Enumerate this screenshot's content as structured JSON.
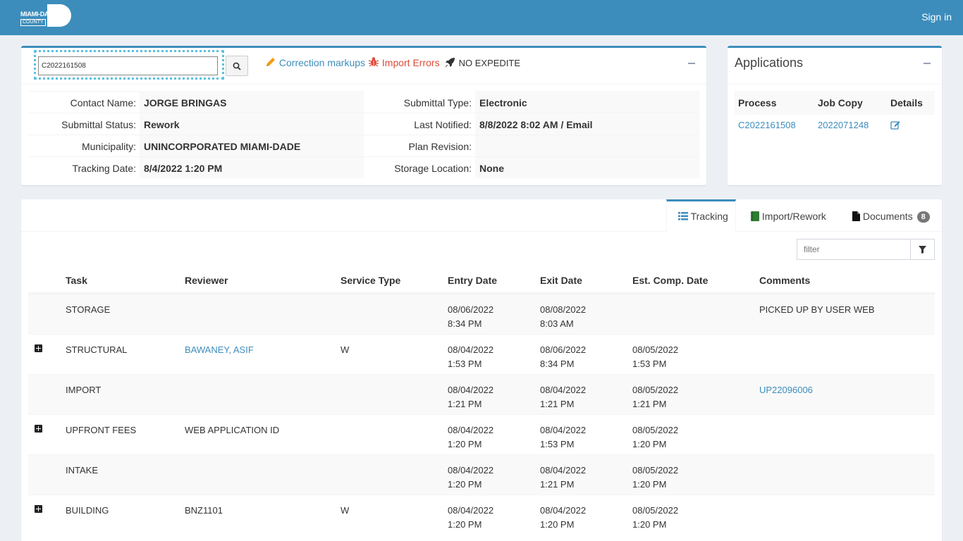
{
  "header": {
    "logo_text": "MIAMI-DADE",
    "logo_county": "COUNTY",
    "sign_in": "Sign in",
    "colors": {
      "bar": "#3c8dbc",
      "link": "#3c8dbc",
      "import_errors": "#dd4b39",
      "pencil": "#f39c12"
    }
  },
  "search": {
    "value": "C2022161508",
    "search_icon": "search-icon"
  },
  "toolbar": {
    "correction_markups": "Correction markups",
    "import_errors": "Import Errors",
    "no_expedite": "NO EXPEDITE"
  },
  "info": {
    "contact_name_label": "Contact Name:",
    "contact_name": "JORGE BRINGAS",
    "submittal_status_label": "Submittal Status:",
    "submittal_status": "Rework",
    "municipality_label": "Municipality:",
    "municipality": "UNINCORPORATED MIAMI-DADE",
    "tracking_date_label": "Tracking Date:",
    "tracking_date": "8/4/2022 1:20 PM",
    "submittal_type_label": "Submittal Type:",
    "submittal_type": "Electronic",
    "last_notified_label": "Last Notified:",
    "last_notified": "8/8/2022 8:02 AM / Email",
    "plan_revision_label": "Plan Revision:",
    "plan_revision": "",
    "storage_location_label": "Storage Location:",
    "storage_location": "None"
  },
  "applications": {
    "title": "Applications",
    "headers": [
      "Process",
      "Job Copy",
      "Details"
    ],
    "rows": [
      {
        "process": "C2022161508",
        "job_copy": "2022071248",
        "details_icon": "edit-icon"
      }
    ]
  },
  "tabs": [
    {
      "label": "Tracking",
      "icon": "list-icon",
      "active": true
    },
    {
      "label": "Import/Rework",
      "icon": "book-icon",
      "active": false
    },
    {
      "label": "Documents",
      "icon": "file-icon",
      "active": false,
      "badge": "8"
    }
  ],
  "filter": {
    "placeholder": "filter"
  },
  "table": {
    "headers": [
      "Task",
      "Reviewer",
      "Service Type",
      "Entry Date",
      "Exit Date",
      "Est. Comp. Date",
      "Comments"
    ],
    "rows": [
      {
        "expand": false,
        "task": "STORAGE",
        "reviewer": "",
        "reviewer_link": false,
        "service": "",
        "entry1": "08/06/2022",
        "entry2": "8:34 PM",
        "exit1": "08/08/2022",
        "exit2": "8:03 AM",
        "est1": "",
        "est2": "",
        "comments": "PICKED UP BY USER WEB",
        "comments_link": false
      },
      {
        "expand": true,
        "task": "STRUCTURAL",
        "reviewer": "BAWANEY, ASIF",
        "reviewer_link": true,
        "service": "W",
        "entry1": "08/04/2022",
        "entry2": "1:53 PM",
        "exit1": "08/06/2022",
        "exit2": "8:34 PM",
        "est1": "08/05/2022",
        "est2": "1:53 PM",
        "comments": "",
        "comments_link": false
      },
      {
        "expand": false,
        "task": "IMPORT",
        "reviewer": "",
        "reviewer_link": false,
        "service": "",
        "entry1": "08/04/2022",
        "entry2": "1:21 PM",
        "exit1": "08/04/2022",
        "exit2": "1:21 PM",
        "est1": "08/05/2022",
        "est2": "1:21 PM",
        "comments": "UP22096006",
        "comments_link": true
      },
      {
        "expand": true,
        "task": "UPFRONT FEES",
        "reviewer": "WEB APPLICATION ID",
        "reviewer_link": false,
        "service": "",
        "entry1": "08/04/2022",
        "entry2": "1:20 PM",
        "exit1": "08/04/2022",
        "exit2": "1:53 PM",
        "est1": "08/05/2022",
        "est2": "1:20 PM",
        "comments": "",
        "comments_link": false
      },
      {
        "expand": false,
        "task": "INTAKE",
        "reviewer": "",
        "reviewer_link": false,
        "service": "",
        "entry1": "08/04/2022",
        "entry2": "1:20 PM",
        "exit1": "08/04/2022",
        "exit2": "1:21 PM",
        "est1": "08/05/2022",
        "est2": "1:20 PM",
        "comments": "",
        "comments_link": false
      },
      {
        "expand": true,
        "task": "BUILDING",
        "reviewer": "BNZ1101",
        "reviewer_link": false,
        "service": "W",
        "entry1": "08/04/2022",
        "entry2": "1:20 PM",
        "exit1": "08/04/2022",
        "exit2": "1:20 PM",
        "est1": "08/05/2022",
        "est2": "1:20 PM",
        "comments": "",
        "comments_link": false
      }
    ]
  }
}
